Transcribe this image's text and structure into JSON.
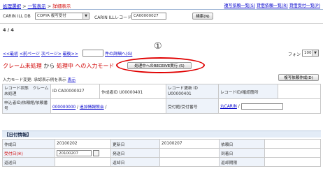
{
  "nav": {
    "breadcrumb": [
      {
        "label": "処理選択"
      },
      {
        "label": "一覧表示"
      },
      {
        "label": "詳細表示"
      }
    ],
    "sep": ">",
    "right_links": [
      {
        "label": "複写依頼一覧(S)"
      },
      {
        "label": "貸借依頼一覧(R)"
      },
      {
        "label": "貸借受付一覧(P)"
      }
    ]
  },
  "search": {
    "db_label": "CARIN ILL DB",
    "db_value": "COPYA 複写受付",
    "id_label": "CARIN ILLレコードID",
    "id_value": "CA00000027",
    "search_button": "検索(N)"
  },
  "pager": {
    "count": "4 / 4",
    "first": "<<最初",
    "prev": "<前ページ",
    "next": "次ページ>",
    "last": "最後>>",
    "detail_link": "件の詳細へ(G)",
    "font_label": "フォント",
    "font_value": "100"
  },
  "mode": {
    "part1": "クレーム未処理",
    "part2": "から",
    "part3": "処理中",
    "part4": "への入力モード",
    "action_button": "処理中へのRECEIVE実行 (S)",
    "annotation_number": "①",
    "accent": "#e00000"
  },
  "mode_change": {
    "label": "入力モード変更:",
    "text": "承認表示例を表示",
    "doc_button": "複写依頼作成(D)"
  },
  "record_table": {
    "r1": {
      "c1": "レコード状態　クレーム未処理",
      "c2": "ID",
      "c2v": "CA00000027",
      "c3": "作成者ID",
      "c3v": "U00000401",
      "c4": "レコード更新 ID",
      "c4v": "U00000401",
      "c5": "レコードID/確認箇所",
      "c5v": ""
    },
    "r2": {
      "c1": "申込者ID/依頼館/依頼番号",
      "link1": "000000000",
      "sep": "/",
      "link2": "追加情報照会",
      "c3": "受付館/受付番号",
      "link3": "丸CARIN"
    }
  },
  "dates": {
    "title": "【日付情報】",
    "rows": [
      [
        "作成日",
        "20100202",
        "更新日",
        "20100207",
        "依頼日",
        ""
      ],
      [
        "受付日(※)",
        "20100207",
        "発送日",
        "",
        "到着日",
        ""
      ],
      [
        "返送日",
        "",
        "返却日",
        "",
        "返却期限",
        ""
      ]
    ]
  }
}
